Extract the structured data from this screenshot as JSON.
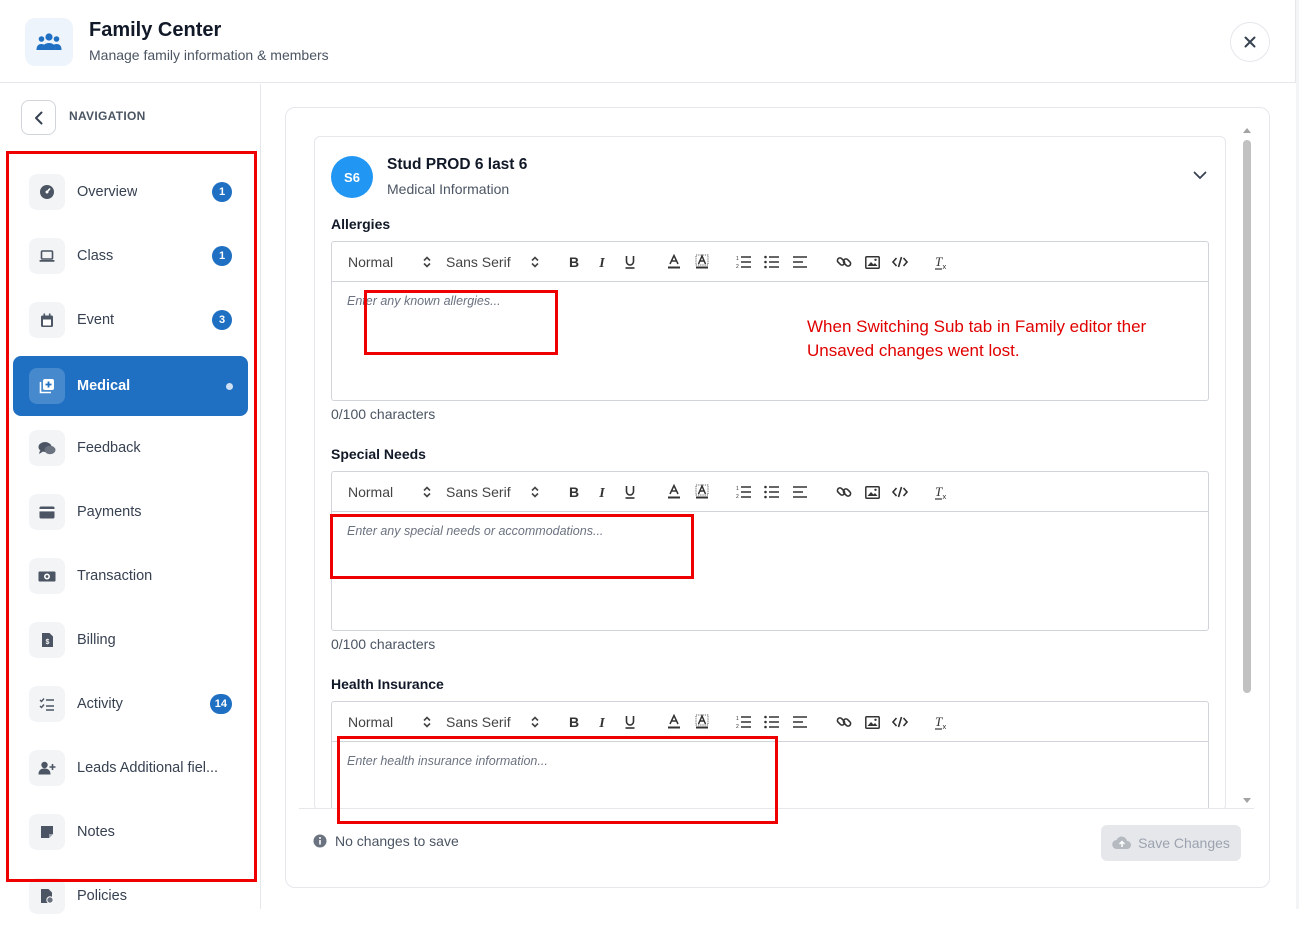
{
  "header": {
    "title": "Family Center",
    "subtitle": "Manage family information & members"
  },
  "sidebar": {
    "section_label": "NAVIGATION",
    "items": [
      {
        "label": "Overview",
        "badge": "1"
      },
      {
        "label": "Class",
        "badge": "1"
      },
      {
        "label": "Event",
        "badge": "3"
      },
      {
        "label": "Medical",
        "badge": ""
      },
      {
        "label": "Feedback",
        "badge": ""
      },
      {
        "label": "Payments",
        "badge": ""
      },
      {
        "label": "Transaction",
        "badge": ""
      },
      {
        "label": "Billing",
        "badge": ""
      },
      {
        "label": "Activity",
        "badge": "14"
      },
      {
        "label": "Leads Additional fiel...",
        "badge": ""
      },
      {
        "label": "Notes",
        "badge": ""
      },
      {
        "label": "Policies",
        "badge": ""
      }
    ],
    "active_item": "Medical"
  },
  "student": {
    "initials": "S6",
    "name": "Stud PROD 6 last 6",
    "section": "Medical Information"
  },
  "toolbar": {
    "heading_select": "Normal",
    "font_select": "Sans Serif"
  },
  "fields": {
    "allergies": {
      "label": "Allergies",
      "placeholder": "Enter any known allergies...",
      "count": "0/100 characters"
    },
    "special_needs": {
      "label": "Special Needs",
      "placeholder": "Enter any special needs or accommodations...",
      "count": "0/100 characters"
    },
    "health_insurance": {
      "label": "Health Insurance",
      "placeholder": "Enter health insurance information..."
    }
  },
  "footer": {
    "status": "No changes to save",
    "save_label": "Save Changes"
  },
  "annotation": {
    "line1": "When Switching Sub tab in Family editor ther",
    "line2": "Unsaved changes went lost."
  },
  "colors": {
    "accent": "#1f6fc2",
    "avatar": "#2196f3",
    "annotation": "#ee0000"
  }
}
